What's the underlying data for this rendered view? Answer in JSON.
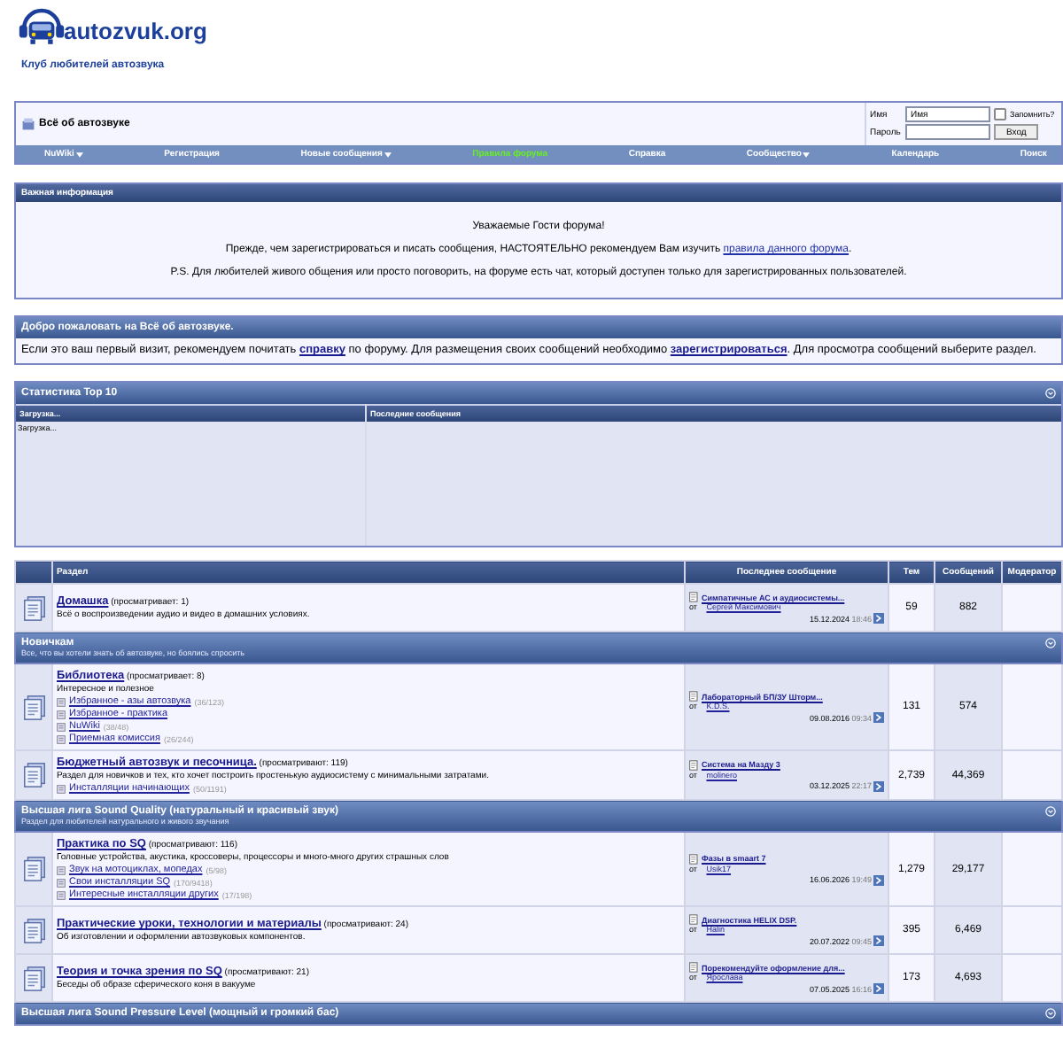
{
  "site": {
    "logo_text": "autozvuk.org",
    "tagline": "Клуб любителей автозвука"
  },
  "breadcrumb": {
    "title": "Всё об автозвуке"
  },
  "login": {
    "username_label": "Имя",
    "username_value": "Имя",
    "remember_label": "Запомнить?",
    "remember_checked": false,
    "password_label": "Пароль",
    "submit": "Вход"
  },
  "nav": [
    {
      "label": "NuWiki",
      "dropdown": true,
      "highlighted": false
    },
    {
      "label": "Регистрация",
      "dropdown": false,
      "highlighted": false
    },
    {
      "label": "Новые сообщения",
      "dropdown": true,
      "highlighted": false
    },
    {
      "label": "Правила форума",
      "dropdown": false,
      "highlighted": true
    },
    {
      "label": "Справка",
      "dropdown": false,
      "highlighted": false
    },
    {
      "label": "Сообщество",
      "dropdown": true,
      "highlighted": false
    },
    {
      "label": "Календарь",
      "dropdown": false,
      "highlighted": false
    },
    {
      "label": "Поиск",
      "dropdown": false,
      "highlighted": false
    }
  ],
  "notice": {
    "title": "Важная информация",
    "paragraphs": [
      {
        "text": "Уважаемые Гости форума!"
      },
      {
        "text": "Прежде, чем зарегистрироваться и писать сообщения, НАСТОЯТЕЛЬНО рекомендуем Вам изучить ",
        "link": "правила данного форума",
        "after": "."
      },
      {
        "text": "P.S. Для любителей живого общения или просто поговорить, на форуме есть чат, который доступен только для зарегистрированных пользователей."
      }
    ]
  },
  "welcome": {
    "title": "Добро пожаловать на Всё об автозвуке.",
    "parts": [
      {
        "text": "Если это ваш первый визит, рекомендуем почитать ",
        "link": "справку"
      },
      {
        "text": " по форуму. Для размещения своих сообщений необходимо ",
        "link": "зарегистрироваться"
      },
      {
        "text": ". Для просмотра сообщений выберите раздел."
      }
    ]
  },
  "stats": {
    "title": "Статистика Top 10",
    "columns": [
      "Загрузка...",
      "Последние сообщения"
    ],
    "loading": "Загрузка..."
  },
  "forum_table": {
    "columns": [
      "Раздел",
      "Последнее сообщение",
      "Тем",
      "Сообщений",
      "Модератор"
    ],
    "categories": [
      {
        "forums": [
          {
            "name": "Домашка",
            "viewing": "(просматривает: 1)",
            "description": "Всё о воспроизведении аудио и видео в домашних условиях.",
            "last_post": {
              "title": "Симпатичные АС и аудиосистемы...",
              "by": "от",
              "author": "Сергей Максимович",
              "date": "15.12.2024",
              "time": "18:46"
            },
            "threads": "59",
            "posts": "882"
          }
        ]
      },
      {
        "title": "Новичкам",
        "description": "Все, что вы хотели знать об автозвуке, но боялись спросить",
        "forums": [
          {
            "name": "Библиотека",
            "viewing": "(просматривает: 8)",
            "description": "Интересное и полезное",
            "subforums": [
              {
                "name": "Избранное - азы автозвука",
                "count": "(36/123)"
              },
              {
                "name": "Избранное - практика"
              },
              {
                "name": "NuWiki",
                "count": "(38/48)"
              },
              {
                "name": "Приемная комиссия",
                "count": "(26/244)"
              }
            ],
            "last_post": {
              "title": "Лабораторный БП/ЗУ Шторм...",
              "by": "от",
              "author": "K.D.S.",
              "date": "09.08.2016",
              "time": "09:34"
            },
            "threads": "131",
            "posts": "574"
          },
          {
            "name": "Бюджетный автозвук и песочница.",
            "viewing": "(просматривают: 119)",
            "description": "Раздел для новичков и тех, кто хочет построить простенькую аудиосистему с минимальными затратами.",
            "subforums": [
              {
                "name": "Инсталляции начинающих",
                "count": "(50/1191)"
              }
            ],
            "last_post": {
              "title": "Система на Мазду 3",
              "by": "от",
              "author": "molinero",
              "date": "03.12.2025",
              "time": "22:17"
            },
            "threads": "2,739",
            "posts": "44,369"
          }
        ]
      },
      {
        "title": "Высшая лига Sound Quality (натуральный и красивый звук)",
        "description": "Раздел для любителей натурального и живого звучания",
        "forums": [
          {
            "name": "Практика по SQ",
            "viewing": "(просматривают: 116)",
            "description": "Головные устройства, акустика, кроссоверы, процессоры и много-много других страшных слов",
            "subforums": [
              {
                "name": "Звук на мотоциклах, мопедах",
                "count": "(5/98)"
              },
              {
                "name": "Свои инсталляции SQ",
                "count": "(170/9418)"
              },
              {
                "name": "Интересные инсталляции других",
                "count": "(17/198)"
              }
            ],
            "last_post": {
              "title": "Фазы в smaart 7",
              "by": "от",
              "author": "Usik17",
              "date": "16.06.2026",
              "time": "19:49"
            },
            "threads": "1,279",
            "posts": "29,177"
          },
          {
            "name": "Практические уроки, технологии и материалы",
            "viewing": "(просматривают: 24)",
            "description": "Об изготовлении и оформлении автозвуковых компонентов.",
            "last_post": {
              "title": "Диагностика HELIX DSP.",
              "by": "от",
              "author": "Halin",
              "date": "20.07.2022",
              "time": "09:45"
            },
            "threads": "395",
            "posts": "6,469"
          },
          {
            "name": "Теория и точка зрения по SQ",
            "viewing": "(просматривают: 21)",
            "description": "Беседы об образе сферического коня в вакууме",
            "last_post": {
              "title": "Порекомендуйте оформление для...",
              "by": "от",
              "author": "Ярослава",
              "date": "07.05.2025",
              "time": "16:16"
            },
            "threads": "173",
            "posts": "4,693"
          }
        ]
      },
      {
        "title": "Высшая лига Sound Pressure Level (мощный и громкий бас)"
      }
    ]
  }
}
